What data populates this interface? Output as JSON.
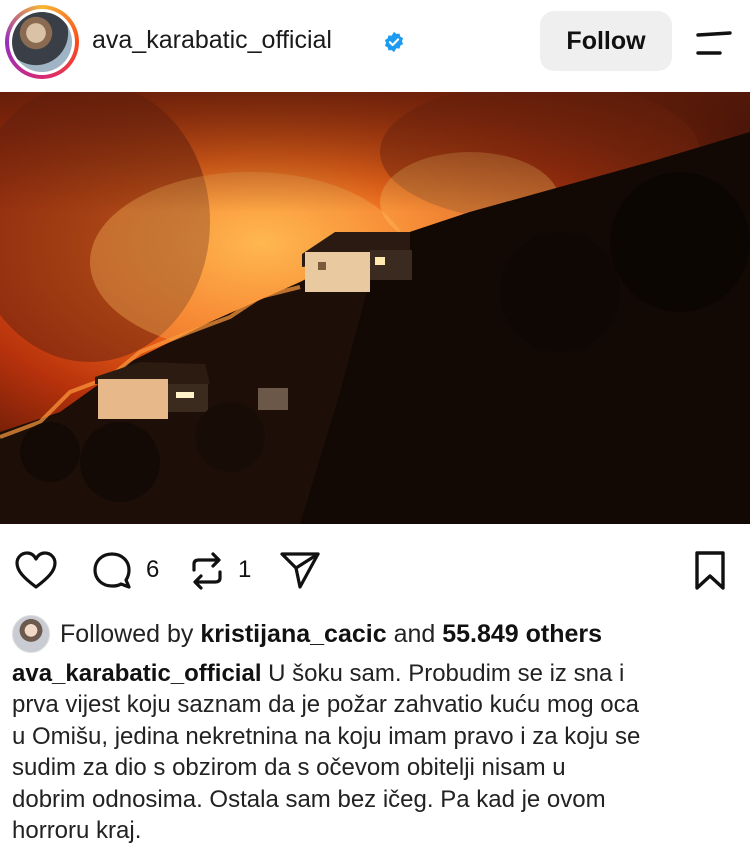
{
  "post": {
    "username": "ava_karabatic_official",
    "verified_icon": "verified-badge-icon",
    "follow_label": "Follow",
    "menu_icon": "menu-icon"
  },
  "actions": {
    "comment_count": "6",
    "repost_count": "1"
  },
  "social": {
    "followed_by_prefix": "Followed by",
    "followed_by_user": "kristijana_cacic",
    "and_label": "and",
    "others_count": "55.849 others"
  },
  "caption": {
    "user": "ava_karabatic_official",
    "lines": [
      " U šoku sam. Probudim se iz sna i",
      "prva vijest koju saznam da je požar zahvatio kuću mog oca",
      "u Omišu, jedina nekretnina na koju imam pravo i za koju se",
      "sudim  za dio s obzirom da s očevom obitelji nisam u",
      "dobrim odnosima. Ostala sam  bez ičeg. Pa kad je ovom",
      "horroru kraj."
    ]
  },
  "colors": {
    "accent_blue": "#1d9bf0",
    "fire_orange": "#f26a1b"
  }
}
